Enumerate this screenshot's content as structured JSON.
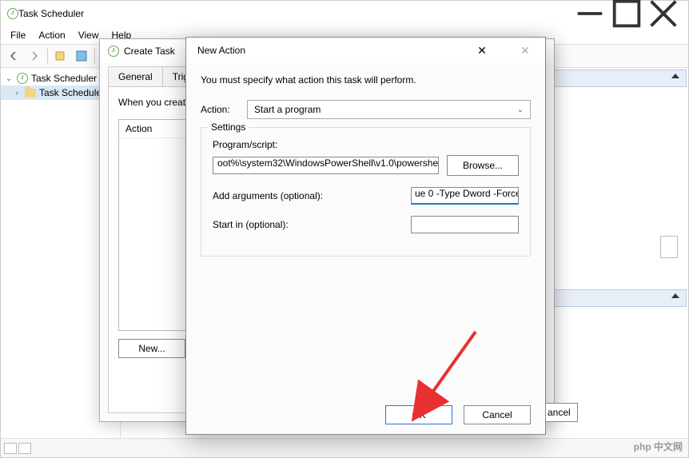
{
  "window": {
    "title": "Task Scheduler",
    "menu": {
      "file": "File",
      "action": "Action",
      "view": "View",
      "help": "Help"
    }
  },
  "tree": {
    "root": "Task Scheduler (L",
    "library": "Task Schedule"
  },
  "create_task": {
    "title": "Create Task",
    "tabs": {
      "general": "General",
      "triggers": "Triggers"
    },
    "intro": "When you create",
    "list_header": "Action",
    "new_btn": "New..."
  },
  "new_action": {
    "title": "New Action",
    "intro": "You must specify what action this task will perform.",
    "action_label": "Action:",
    "action_value": "Start a program",
    "settings_legend": "Settings",
    "program_label": "Program/script:",
    "program_value": "oot%\\system32\\WindowsPowerShell\\v1.0\\powershell.exe",
    "browse_btn": "Browse...",
    "args_label": "Add arguments (optional):",
    "args_value": "ue 0 -Type Dword -Force",
    "startin_label": "Start in (optional):",
    "startin_value": "",
    "ok_btn": "OK",
    "cancel_btn": "Cancel",
    "extra_btn": "ancel"
  },
  "watermark": "php 中文网"
}
